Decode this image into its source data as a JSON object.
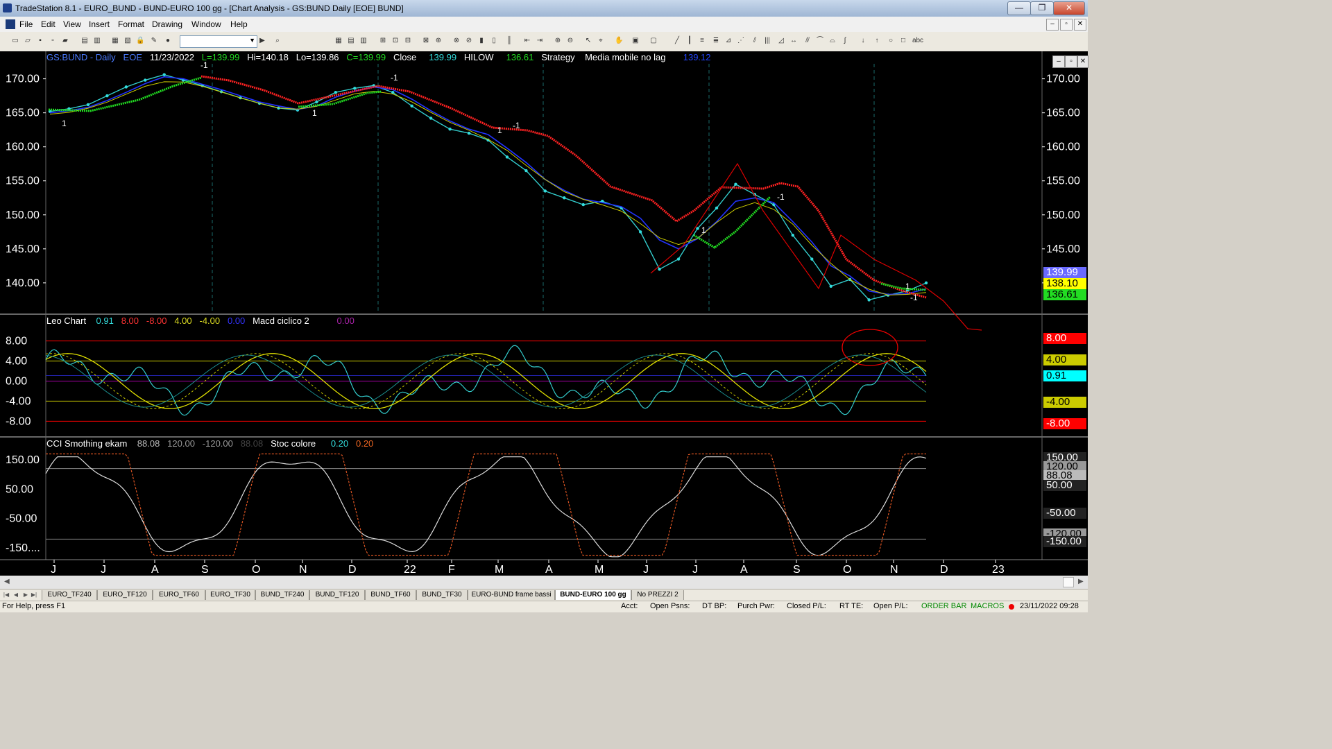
{
  "window": {
    "title": "TradeStation 8.1 - EURO_BUND - BUND-EURO 100 gg - [Chart Analysis - GS:BUND  Daily  [EOE] BUND]",
    "controls": [
      "—",
      "❐",
      "✕"
    ]
  },
  "menu": [
    "File",
    "Edit",
    "View",
    "Insert",
    "Format",
    "Drawing",
    "Window",
    "Help"
  ],
  "mdi_controls": [
    "–",
    "▫",
    "✕"
  ],
  "panel_controls": [
    "–",
    "▫",
    "✕"
  ],
  "price_header": {
    "symbol": "GS:BUND - Daily",
    "exch": "EOE",
    "date": "11/23/2022",
    "last": "L=139.99",
    "hi": "Hi=140.18",
    "lo": "Lo=139.86",
    "close": "C=139.99",
    "close_label": "Close",
    "close_value": "139.99",
    "hilow_label": "HILOW",
    "hilow_value": "136.61",
    "strategy_label": "Strategy",
    "mm_label": "Media mobile no lag",
    "mm_value": "139.12"
  },
  "price_axis": [
    "170.00",
    "165.00",
    "160.00",
    "155.00",
    "150.00",
    "145.00",
    "140.00"
  ],
  "price_tags": [
    {
      "text": "139.99",
      "bg": "#6a6aff",
      "fg": "#ffffff"
    },
    {
      "text": "138.10",
      "bg": "#ffff00",
      "fg": "#000000"
    },
    {
      "text": "136.61",
      "bg": "#22dd22",
      "fg": "#000000"
    }
  ],
  "trade_marks": [
    "1",
    "-1",
    "1",
    "-1",
    "1",
    "-1",
    "-1",
    "1",
    "-1",
    "1"
  ],
  "leo_header": {
    "name": "Leo Chart",
    "v1": "0.91",
    "v2": "8.00",
    "v3": "-8.00",
    "v4": "4.00",
    "v5": "-4.00",
    "v6": "0.00",
    "macd_name": "Macd ciclico 2",
    "macd_value": "0.00"
  },
  "leo_axis": [
    "8.00",
    "4.00",
    "0.00",
    "-4.00",
    "-8.00"
  ],
  "leo_tags": [
    {
      "text": "8.00",
      "bg": "#ff0000",
      "fg": "#ffffff"
    },
    {
      "text": "4.00",
      "bg": "#cccc00",
      "fg": "#000000"
    },
    {
      "text": "0.91",
      "bg": "#00ffff",
      "fg": "#000000"
    },
    {
      "text": "-4.00",
      "bg": "#cccc00",
      "fg": "#000000"
    },
    {
      "text": "-8.00",
      "bg": "#ff0000",
      "fg": "#ffffff"
    }
  ],
  "cci_header": {
    "name": "CCI Smothing ekam",
    "v1": "88.08",
    "v2": "120.00",
    "v3": "-120.00",
    "v4": "88.08",
    "stoc_name": "Stoc colore",
    "stoc1": "0.20",
    "stoc2": "0.20"
  },
  "cci_axis": [
    "150.00",
    "50.00",
    "-50.00",
    "-150...."
  ],
  "cci_tags": [
    {
      "text": "150.00",
      "bg": "#222222",
      "fg": "#ffffff"
    },
    {
      "text": "120.00",
      "bg": "#999999",
      "fg": "#000000"
    },
    {
      "text": "88.08",
      "bg": "#bbbbbb",
      "fg": "#000000"
    },
    {
      "text": "50.00",
      "bg": "#222222",
      "fg": "#ffffff"
    },
    {
      "text": "-50.00",
      "bg": "#222222",
      "fg": "#ffffff"
    },
    {
      "text": "-120.00",
      "bg": "#999999",
      "fg": "#000000"
    },
    {
      "text": "-150.00",
      "bg": "#222222",
      "fg": "#ffffff"
    }
  ],
  "time_axis": [
    "J",
    "J",
    "A",
    "S",
    "O",
    "N",
    "D",
    "22",
    "F",
    "M",
    "A",
    "M",
    "J",
    "J",
    "A",
    "S",
    "O",
    "N",
    "D",
    "23"
  ],
  "tabs": [
    "EURO_TF240",
    "EURO_TF120",
    "EURO_TF60",
    "EURO_TF30",
    "BUND_TF240",
    "BUND_TF120",
    "BUND_TF60",
    "BUND_TF30",
    "EURO-BUND frame bassi",
    "BUND-EURO 100 gg",
    "No PREZZI 2"
  ],
  "active_tab": "BUND-EURO 100 gg",
  "status": {
    "help": "For Help, press F1",
    "acct": "Acct:",
    "open_psns": "Open Psns:",
    "dt_bp": "DT BP:",
    "purch_pwr": "Purch Pwr:",
    "closed_pl": "Closed P/L:",
    "rt_te": "RT TE:",
    "open_pl": "Open P/L:",
    "order_bar": "ORDER BAR",
    "macros": "MACROS",
    "datetime": "23/11/2022 09:28"
  },
  "chart_data": {
    "type": "line",
    "title": "GS:BUND - Daily",
    "months": [
      "J",
      "J",
      "A",
      "S",
      "O",
      "N",
      "D",
      "22",
      "F",
      "M",
      "A",
      "M",
      "J",
      "J",
      "A",
      "S",
      "O",
      "N",
      "D",
      "23"
    ],
    "price_range": [
      135.5,
      172
    ],
    "price_series": [
      165.2,
      165.6,
      166.2,
      167.5,
      168.8,
      169.8,
      170.6,
      169.8,
      169.0,
      168.1,
      167.2,
      166.4,
      165.7,
      165.4,
      166.6,
      168.0,
      168.6,
      169.0,
      168.0,
      166.0,
      164.2,
      162.6,
      162.0,
      161.0,
      158.5,
      156.5,
      153.5,
      152.5,
      151.5,
      152.0,
      151.0,
      147.5,
      142.0,
      143.5,
      148.0,
      151.0,
      154.5,
      153.0,
      151.5,
      147.0,
      143.5,
      139.5,
      140.5,
      137.5,
      138.2,
      138.8,
      139.99
    ],
    "blue_ma": [
      165.0,
      165.3,
      165.8,
      166.8,
      168.0,
      169.3,
      170.3,
      170.0,
      169.2,
      168.4,
      167.5,
      166.6,
      166.0,
      165.5,
      166.0,
      167.3,
      168.2,
      168.8,
      168.4,
      167.0,
      165.3,
      163.8,
      162.6,
      161.8,
      159.8,
      157.7,
      155.2,
      153.6,
      152.3,
      151.8,
      151.2,
      149.5,
      146.3,
      145.0,
      146.5,
      149.0,
      152.0,
      152.5,
      151.8,
      149.0,
      146.0,
      142.5,
      141.0,
      138.8,
      138.3,
      138.4,
      139.12
    ],
    "red_hilow_last": 136.61,
    "leo_range": [
      -11,
      11
    ],
    "leo_levels": [
      8,
      4,
      0,
      -4,
      -8
    ],
    "cci_range": [
      -190,
      190
    ],
    "cci_levels": [
      120,
      -120
    ]
  }
}
